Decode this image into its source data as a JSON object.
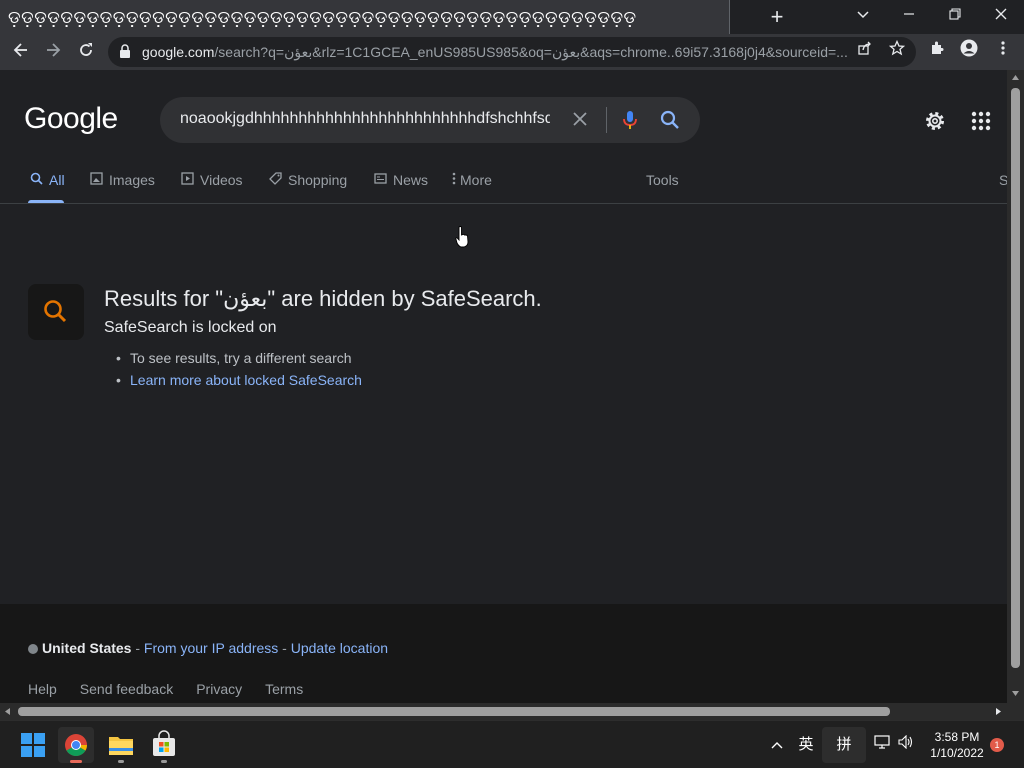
{
  "browser": {
    "tab_title": "ଡ଼ଡ଼ଡ଼ଡ଼ଡ଼ଡ଼ଡ଼ଡ଼ଡ଼ଡ଼ଡ଼ଡ଼ଡ଼ଡ଼ଡ଼ଡ଼ଡ଼ଡ଼ଡ଼ଡ଼ଡ଼ଡ଼ଡ଼ଡ଼ଡ଼ଡ଼ଡ଼ଡ଼ଡ଼ଡ଼ଡ଼ଡ଼ଡ଼ଡ଼ଡ଼ଡ଼ଡ଼ଡ଼ଡ଼ଡ଼ଡ଼ଡ଼ଡ଼ଡ଼ଡ଼ଡ଼ଡ଼ଡ଼",
    "new_tab_icon": "+",
    "url_host": "google.com",
    "url_rest": "/search?q=بعؤن&rlz=1C1GCEA_enUS985US985&oq=بعؤن&aqs=chrome..69i57.3168j0j4&sourceid=..."
  },
  "google": {
    "logo": "Google",
    "query": "noaookjgdhhhhhhhhhhhhhhhhhhhhhhhhhdfshchhfsdh",
    "tabs": [
      {
        "label": "All",
        "icon": "search-icon"
      },
      {
        "label": "Images",
        "icon": "image-icon"
      },
      {
        "label": "Videos",
        "icon": "video-icon"
      },
      {
        "label": "Shopping",
        "icon": "tag-icon"
      },
      {
        "label": "News",
        "icon": "news-icon"
      },
      {
        "label": "More",
        "icon": "more-vert-icon"
      }
    ],
    "tools_label": "Tools",
    "partial_label": "S"
  },
  "result": {
    "title": "Results for \"بعؤن\" are hidden by SafeSearch.",
    "subtitle": "SafeSearch is locked on",
    "bullet_1": "To see results, try a different search",
    "bullet_2_link": "Learn more about locked SafeSearch"
  },
  "footer": {
    "country": "United States",
    "sep1": " - ",
    "from_ip": "From your IP address",
    "sep2": " - ",
    "update_location": "Update location",
    "links": [
      "Help",
      "Send feedback",
      "Privacy",
      "Terms"
    ]
  },
  "taskbar": {
    "time": "3:58 PM",
    "date": "1/10/2022",
    "ime_lang": "英",
    "ime_mode": "拼",
    "notification_count": "1",
    "chevron": "^"
  },
  "colors": {
    "page_bg": "#202124",
    "link": "#8ab4f8",
    "footer_bg": "#171717",
    "taskbar_bg": "#202020"
  }
}
